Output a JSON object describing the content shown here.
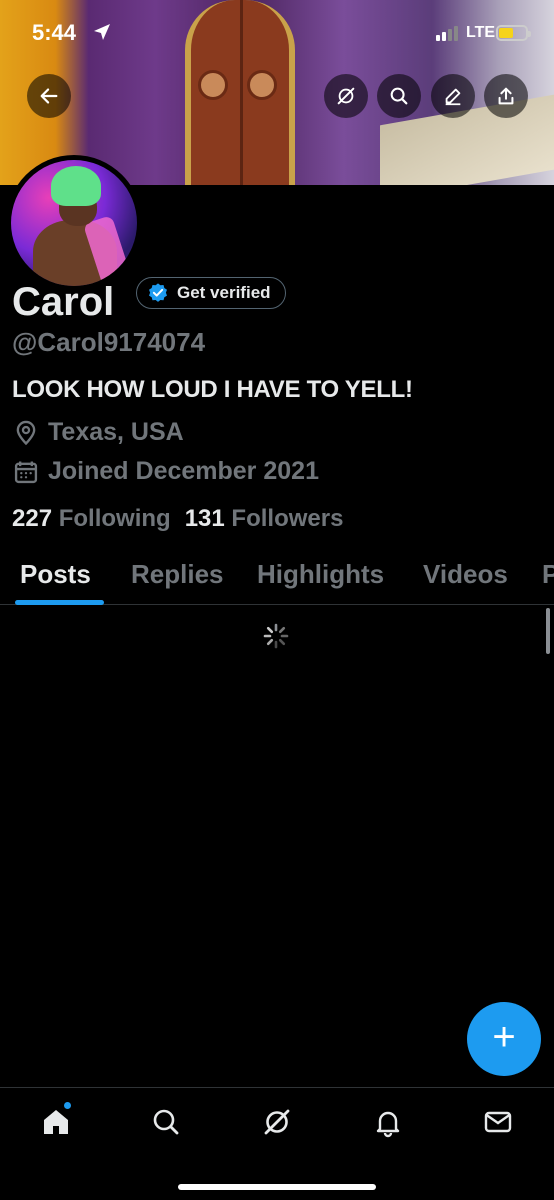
{
  "status_bar": {
    "time": "5:44",
    "network": "LTE",
    "battery_color": "#f5d31a"
  },
  "header": {
    "back_icon": "arrow-left-icon",
    "actions": [
      "grok-icon",
      "search-icon",
      "edit-icon",
      "share-icon"
    ]
  },
  "profile": {
    "name": "Carol",
    "verify_label": "Get verified",
    "handle": "@Carol9174074",
    "bio": "LOOK HOW LOUD I HAVE TO YELL!",
    "location": "Texas, USA",
    "joined": "Joined December 2021",
    "following_count": "227",
    "following_label": "Following",
    "followers_count": "131",
    "followers_label": "Followers"
  },
  "tabs": [
    {
      "label": "Posts",
      "active": true
    },
    {
      "label": "Replies",
      "active": false
    },
    {
      "label": "Highlights",
      "active": false
    },
    {
      "label": "Videos",
      "active": false
    },
    {
      "label": "P",
      "active": false
    }
  ],
  "fab": {
    "label": "+"
  },
  "bottom_nav": {
    "items": [
      "home-icon",
      "search-icon",
      "grok-icon",
      "notifications-icon",
      "messages-icon"
    ]
  },
  "colors": {
    "accent": "#1d9bf0",
    "background": "#000000",
    "text_primary": "#e7e9ea",
    "text_secondary": "#71767b"
  }
}
